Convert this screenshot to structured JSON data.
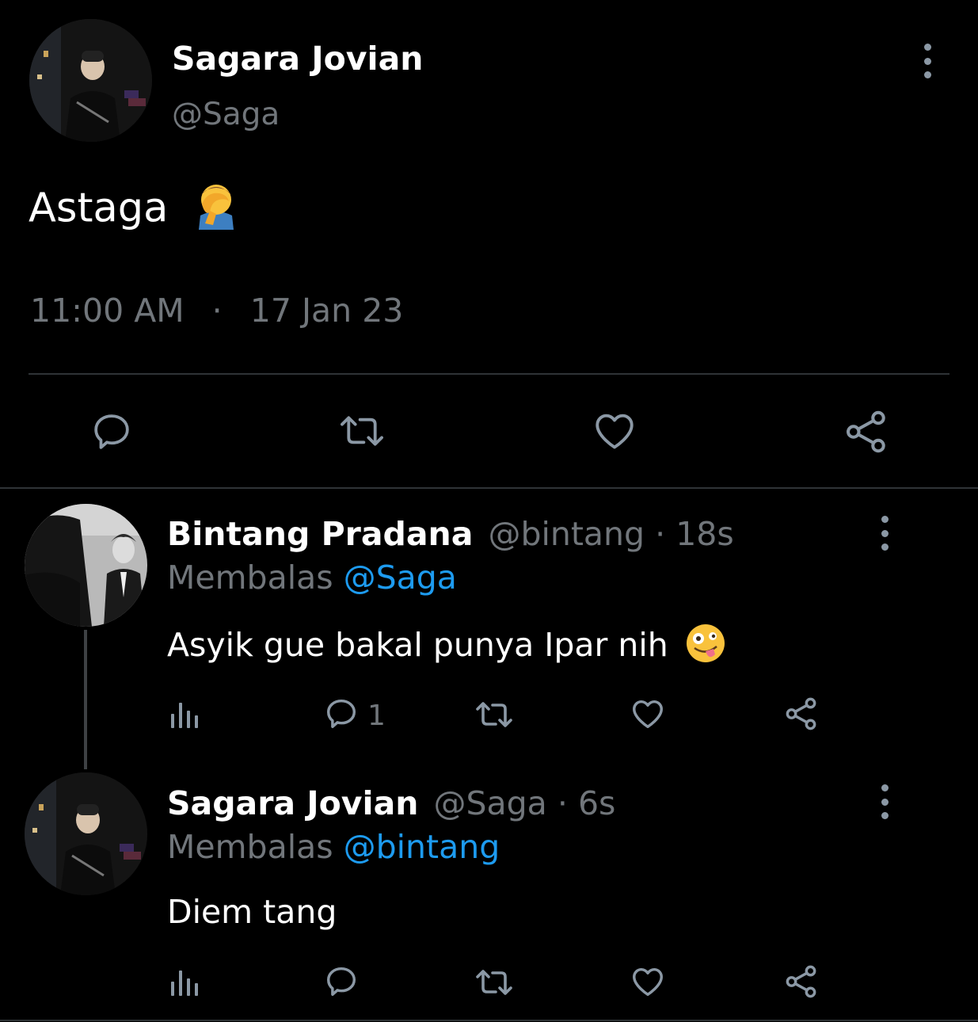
{
  "main_tweet": {
    "author_name": "Sagara Jovian",
    "author_handle": "@Saga",
    "text": "Astaga",
    "text_emoji": "facepalm-emoji",
    "time": "11:00 AM",
    "separator": "·",
    "date": "17 Jan 23",
    "actions": [
      "reply-icon",
      "retweet-icon",
      "like-icon",
      "share-icon"
    ]
  },
  "replies": [
    {
      "author_name": "Bintang Pradana",
      "author_handle": "@bintang",
      "separator": "·",
      "age": "18s",
      "replying_prefix": "Membalas",
      "replying_to": "@Saga",
      "text": "Asyik gue bakal punya Ipar nih",
      "text_emoji": "zany-face-emoji",
      "reply_count": "1"
    },
    {
      "author_name": "Sagara Jovian",
      "author_handle": "@Saga",
      "separator": "·",
      "age": "6s",
      "replying_prefix": "Membalas",
      "replying_to": "@bintang",
      "text": "Diem tang",
      "reply_count": ""
    }
  ],
  "colors": {
    "background": "#000000",
    "text": "#e7e9ea",
    "muted": "#71767b",
    "link": "#1d9bf0",
    "divider": "#2f3336"
  }
}
